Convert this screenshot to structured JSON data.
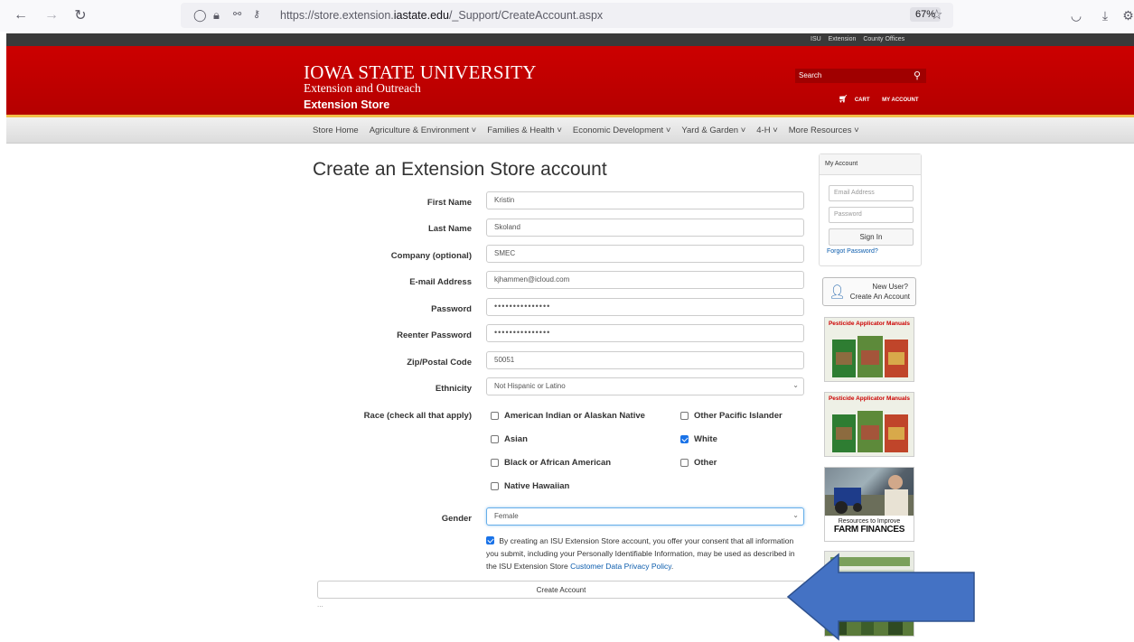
{
  "browser": {
    "url_prefix": "https://store.extension.",
    "url_domain": "iastate.edu",
    "url_suffix": "/_Support/CreateAccount.aspx",
    "zoom": "67%"
  },
  "header": {
    "top_links": [
      "ISU",
      "Extension",
      "County Offices"
    ],
    "logo_main": "IOWA STATE UNIVERSITY",
    "logo_sub": "Extension and Outreach",
    "store_name": "Extension Store",
    "search_placeholder": "Search",
    "cart_label": "CART",
    "account_label": "MY ACCOUNT"
  },
  "nav": {
    "items": [
      "Store Home",
      "Agriculture & Environment ˅",
      "Families & Health ˅",
      "Economic Development ˅",
      "Yard & Garden ˅",
      "4-H ˅",
      "More Resources ˅"
    ]
  },
  "form": {
    "title": "Create an Extension Store account",
    "fields": {
      "first_name": {
        "label": "First Name",
        "value": "Kristin"
      },
      "last_name": {
        "label": "Last Name",
        "value": "Skoland"
      },
      "company": {
        "label": "Company (optional)",
        "value": "SMEC"
      },
      "email": {
        "label": "E-mail Address",
        "value": "kjhammen@icloud.com"
      },
      "password": {
        "label": "Password",
        "value": "•••••••••••••••"
      },
      "reenter_password": {
        "label": "Reenter Password",
        "value": "•••••••••••••••"
      },
      "zip": {
        "label": "Zip/Postal Code",
        "value": "50051"
      },
      "ethnicity": {
        "label": "Ethnicity",
        "value": "Not Hispanic or Latino"
      },
      "race": {
        "label": "Race (check all that apply)"
      },
      "gender": {
        "label": "Gender",
        "value": "Female"
      }
    },
    "race_options": {
      "american_indian": {
        "label": "American Indian or Alaskan Native",
        "checked": false
      },
      "other_pacific": {
        "label": "Other Pacific Islander",
        "checked": false
      },
      "asian": {
        "label": "Asian",
        "checked": false
      },
      "white": {
        "label": "White",
        "checked": true
      },
      "black": {
        "label": "Black or African American",
        "checked": false
      },
      "other": {
        "label": "Other",
        "checked": false
      },
      "native_hawaiian": {
        "label": "Native Hawaiian",
        "checked": false
      }
    },
    "consent_text": "By creating an ISU Extension Store account, you offer your consent that all information you submit, including your Personally Identifiable Information, may be used as described in the ISU Extension Store",
    "consent_link": "Customer Data Privacy Policy",
    "consent_end": ".",
    "submit_label": "Create Account",
    "dots": "..."
  },
  "sidebar": {
    "account_title": "My Account",
    "email_placeholder": "Email Address",
    "password_placeholder": "Password",
    "signin_label": "Sign In",
    "forgot_label": "Forgot Password?",
    "new_user_line1": "New User?",
    "new_user_line2": "Create An Account",
    "promo1_title": "Pesticide Applicator Manuals",
    "promo2_title": "Pesticide Applicator Manuals",
    "farm_line1": "Resources to Improve",
    "farm_line2": "FARM FINANCES"
  },
  "colors": {
    "isu_red": "#c8102e",
    "isu_gold": "#f1be48",
    "overlay_arrow": "#4472c4"
  }
}
